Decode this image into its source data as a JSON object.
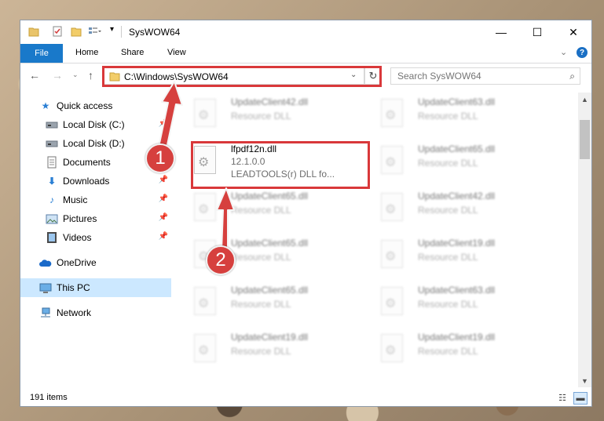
{
  "window": {
    "title": "SysWOW64",
    "controls": {
      "minimize": "—",
      "maximize": "☐",
      "close": "✕"
    }
  },
  "ribbon": {
    "file_tab": "File",
    "tabs": [
      "Home",
      "Share",
      "View"
    ],
    "accent": "#1979ca"
  },
  "nav": {
    "address": "C:\\Windows\\SysWOW64",
    "search_placeholder": "Search SysWOW64"
  },
  "sidebar": {
    "items": [
      {
        "label": "Quick access",
        "icon": "star-icon",
        "pinned": false
      },
      {
        "label": "Local Disk (C:)",
        "icon": "drive-icon",
        "pinned": true
      },
      {
        "label": "Local Disk (D:)",
        "icon": "drive-icon",
        "pinned": true
      },
      {
        "label": "Documents",
        "icon": "documents-icon",
        "pinned": true
      },
      {
        "label": "Downloads",
        "icon": "download-icon",
        "pinned": true
      },
      {
        "label": "Music",
        "icon": "music-icon",
        "pinned": true
      },
      {
        "label": "Pictures",
        "icon": "pictures-icon",
        "pinned": true
      },
      {
        "label": "Videos",
        "icon": "videos-icon",
        "pinned": true
      },
      {
        "label": "OneDrive",
        "icon": "cloud-icon",
        "pinned": false
      },
      {
        "label": "This PC",
        "icon": "computer-icon",
        "pinned": false,
        "selected": true
      },
      {
        "label": "Network",
        "icon": "network-icon",
        "pinned": false
      }
    ]
  },
  "files": {
    "left": [
      {
        "name": "UpdateClient42.dll",
        "sub": "Resource DLL",
        "blurred": true
      },
      {
        "name": "lfpdf12n.dll",
        "version": "12.1.0.0",
        "desc": "LEADTOOLS(r) DLL fo...",
        "blurred": false
      },
      {
        "name": "UpdateClient65.dll",
        "sub": "Resource DLL",
        "blurred": true
      },
      {
        "name": "UpdateClient65.dll",
        "sub": "Resource DLL",
        "blurred": true
      },
      {
        "name": "UpdateClient65.dll",
        "sub": "Resource DLL",
        "blurred": true
      },
      {
        "name": "UpdateClient19.dll",
        "sub": "Resource DLL",
        "blurred": true
      }
    ],
    "right": [
      {
        "name": "UpdateClient63.dll",
        "sub": "Resource DLL"
      },
      {
        "name": "UpdateClient65.dll",
        "sub": "Resource DLL"
      },
      {
        "name": "UpdateClient42.dll",
        "sub": "Resource DLL"
      },
      {
        "name": "UpdateClient19.dll",
        "sub": "Resource DLL"
      },
      {
        "name": "UpdateClient63.dll",
        "sub": "Resource DLL"
      },
      {
        "name": "UpdateClient19.dll",
        "sub": "Resource DLL"
      }
    ]
  },
  "status": {
    "count": "191 items"
  },
  "annotations": {
    "step1": "1",
    "step2": "2",
    "highlight_color": "#d9383a"
  }
}
